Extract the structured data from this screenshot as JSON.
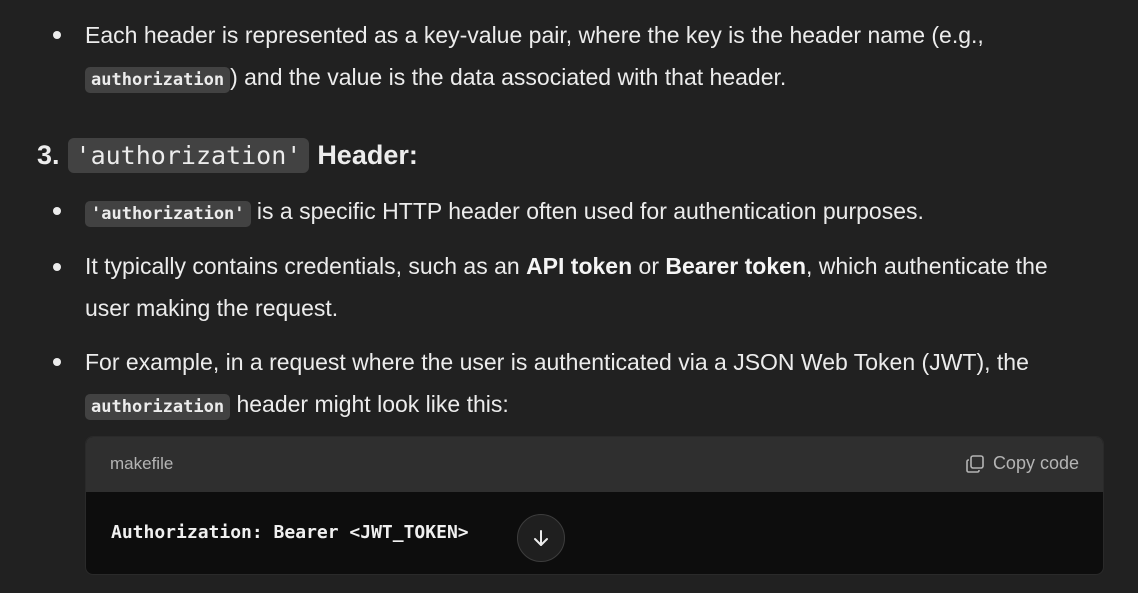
{
  "bullets_top": {
    "item1": {
      "line1": "Each header is represented as a key-value pair, where the key is the header name (e.g.,",
      "code": "authorization",
      "line2_rest": ") and the value is the data associated with that header."
    }
  },
  "section": {
    "number": "3.",
    "code": "'authorization'",
    "title": "Header:"
  },
  "bullets": {
    "b1": {
      "code": "'authorization'",
      "text": " is a specific HTTP header often used for authentication purposes."
    },
    "b2": {
      "pre": "It typically contains credentials, such as an ",
      "bold1": "API token",
      "mid": " or ",
      "bold2": "Bearer token",
      "post": ", which authenticate the",
      "line2": "user making the request."
    },
    "b3": {
      "line1": "For example, in a request where the user is authenticated via a JSON Web Token (JWT), the",
      "code": "authorization",
      "line2_rest": " header might look like this:"
    }
  },
  "code_block": {
    "language": "makefile",
    "copy_label": "Copy code",
    "code": "Authorization: Bearer <JWT_TOKEN>",
    "scroll_icon": "arrow-down-icon"
  },
  "colors": {
    "background": "#212121",
    "text": "#ececec",
    "inline_code_bg": "#424242",
    "code_block_bg": "#0d0d0d",
    "code_header_bg": "#2f2f2f"
  }
}
